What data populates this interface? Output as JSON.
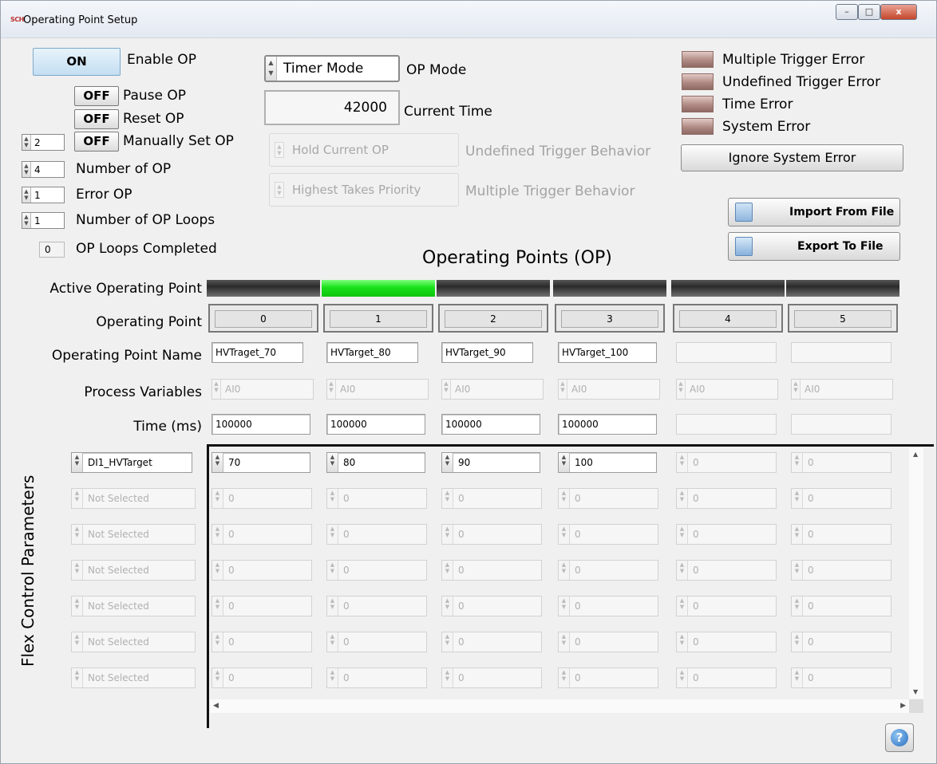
{
  "window": {
    "title": "Operating Point Setup",
    "app_icon": "SCH",
    "controls": {
      "minimize": "–",
      "maximize": "□",
      "close": "x"
    }
  },
  "left": {
    "enable": {
      "state": "ON",
      "label": "Enable OP"
    },
    "pause": {
      "state": "OFF",
      "label": "Pause OP"
    },
    "reset": {
      "state": "OFF",
      "label": "Reset OP"
    },
    "manual": {
      "value": "2",
      "state": "OFF",
      "label": "Manually Set OP"
    },
    "num_op": {
      "value": "4",
      "label": "Number of OP"
    },
    "error_op": {
      "value": "1",
      "label": "Error OP"
    },
    "num_loops": {
      "value": "1",
      "label": "Number of OP Loops"
    },
    "loops_completed": {
      "value": "0",
      "label": "OP Loops Completed"
    }
  },
  "middle": {
    "op_mode": {
      "value": "Timer Mode",
      "label": "OP Mode"
    },
    "current_time": {
      "value": "42000",
      "label": "Current Time"
    },
    "undefined_trigger": {
      "value": "Hold Current OP",
      "label": "Undefined Trigger Behavior"
    },
    "multiple_trigger": {
      "value": "Highest Takes Priority",
      "label": "Multiple Trigger Behavior"
    }
  },
  "errors": {
    "items": [
      "Multiple Trigger Error",
      "Undefined Trigger Error",
      "Time Error",
      "System Error"
    ],
    "ignore_button": "Ignore System Error",
    "led_color": "#b08a84"
  },
  "file": {
    "import": "Import From File",
    "export": "Export To File"
  },
  "grid": {
    "title": "Operating Points (OP)",
    "row_labels": {
      "active": "Active Operating Point",
      "op": "Operating Point",
      "name": "Operating Point Name",
      "pv": "Process Variables",
      "time": "Time (ms)"
    },
    "active_index": 1,
    "active_color": "#19e119",
    "columns": [
      {
        "num": "0",
        "name": "HVTraget_70",
        "pv": "AI0",
        "time": "100000",
        "enabled": true
      },
      {
        "num": "1",
        "name": "HVTarget_80",
        "pv": "AI0",
        "time": "100000",
        "enabled": true
      },
      {
        "num": "2",
        "name": "HVTarget_90",
        "pv": "AI0",
        "time": "100000",
        "enabled": true
      },
      {
        "num": "3",
        "name": "HVTarget_100",
        "pv": "AI0",
        "time": "100000",
        "enabled": true
      },
      {
        "num": "4",
        "name": "",
        "pv": "AI0",
        "time": "",
        "enabled": false
      },
      {
        "num": "5",
        "name": "",
        "pv": "AI0",
        "time": "",
        "enabled": false
      }
    ],
    "flex_title": "Flex Control Parameters",
    "flex_rows": [
      {
        "param": "DI1_HVTarget",
        "values": [
          "70",
          "80",
          "90",
          "100",
          "0",
          "0"
        ],
        "enabled": true
      },
      {
        "param": "Not Selected",
        "values": [
          "0",
          "0",
          "0",
          "0",
          "0",
          "0"
        ],
        "enabled": false
      },
      {
        "param": "Not Selected",
        "values": [
          "0",
          "0",
          "0",
          "0",
          "0",
          "0"
        ],
        "enabled": false
      },
      {
        "param": "Not Selected",
        "values": [
          "0",
          "0",
          "0",
          "0",
          "0",
          "0"
        ],
        "enabled": false
      },
      {
        "param": "Not Selected",
        "values": [
          "0",
          "0",
          "0",
          "0",
          "0",
          "0"
        ],
        "enabled": false
      },
      {
        "param": "Not Selected",
        "values": [
          "0",
          "0",
          "0",
          "0",
          "0",
          "0"
        ],
        "enabled": false
      },
      {
        "param": "Not Selected",
        "values": [
          "0",
          "0",
          "0",
          "0",
          "0",
          "0"
        ],
        "enabled": false
      }
    ]
  },
  "help": "?"
}
